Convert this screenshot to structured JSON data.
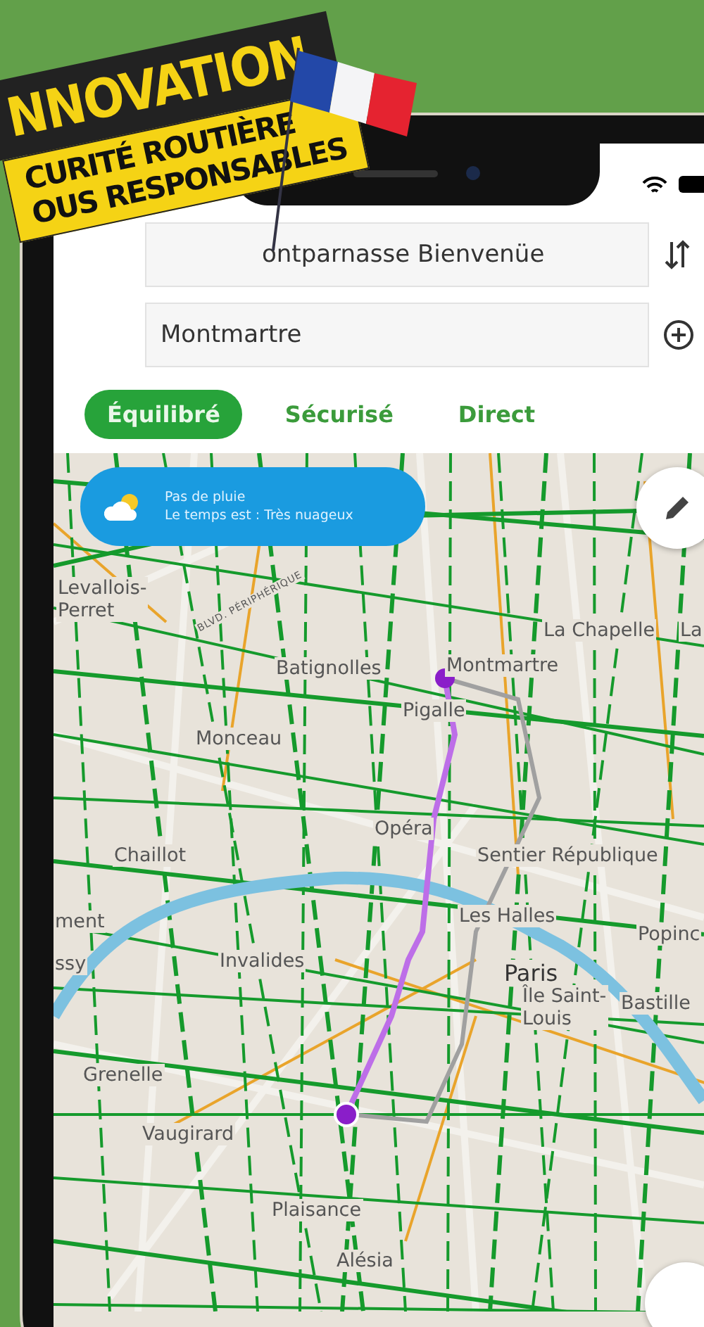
{
  "banner": {
    "title": "NNOVATION",
    "slogan": [
      "CURITÉ ROUTIÈRE",
      "OUS RESPONSABLES"
    ]
  },
  "route_form": {
    "from": {
      "value": "ontparnasse Bienvenüe"
    },
    "to": {
      "value": "Montmartre"
    }
  },
  "route_modes": [
    {
      "label": "Équilibré",
      "selected": true
    },
    {
      "label": "Sécurisé",
      "selected": false
    },
    {
      "label": "Direct",
      "selected": false
    }
  ],
  "weather": {
    "line_1": "Pas de pluie",
    "line_2": "Le temps est : Très nuageux"
  },
  "map": {
    "places": [
      "Levallois-\nPerret",
      "BLVD. PÉRIPHÉRIQUE",
      "La Chapelle",
      "La",
      "Batignolles",
      "Montmartre",
      "Pigalle",
      "Monceau",
      "Chaillot",
      "Opéra",
      "Sentier République",
      "ment",
      "Les Halles",
      "Popinc",
      "ssy",
      "Invalides",
      "Paris",
      "Île Saint-\nLouis",
      "Bastille",
      "Grenelle",
      "Vaugirard",
      "Plaisance",
      "Alésia"
    ]
  }
}
